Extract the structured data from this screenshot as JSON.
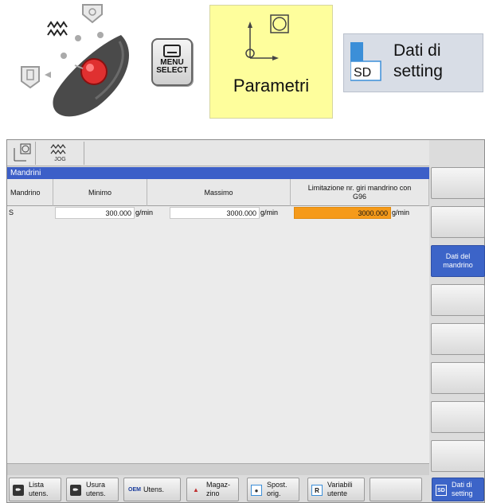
{
  "top_strip": {
    "menu_select_key": {
      "line1": "MENU",
      "line2": "SELECT"
    },
    "parametri_key": {
      "label": "Parametri"
    },
    "setting_key": {
      "icon_text": "SD",
      "line1": "Dati di",
      "line2": "setting"
    }
  },
  "hmi": {
    "header": {
      "mode_text": "JOG"
    },
    "panel_title": "Mandrini",
    "table": {
      "columns": {
        "spindle": "Mandrino",
        "min": "Minimo",
        "max": "Massimo",
        "limit": "Limitazione nr. giri mandrino con G96"
      },
      "rows": [
        {
          "spindle": "S",
          "min": "300.000",
          "min_unit": "g/min",
          "max": "3000.000",
          "max_unit": "g/min",
          "limit": "3000.000",
          "limit_unit": "g/min"
        }
      ]
    },
    "vertical_softkeys": [
      "",
      "",
      "Dati del mandrino",
      "",
      "",
      "",
      "",
      ""
    ],
    "active_vertical_softkey": "Dati del mandrino",
    "horizontal_softkeys": [
      {
        "icon_text": "",
        "label": "Lista\nutens."
      },
      {
        "icon_text": "",
        "label": "Usura\nutens."
      },
      {
        "icon_text": "OEM",
        "label": "Utens."
      },
      {
        "icon_text": "",
        "label": "Magaz-\nzino"
      },
      {
        "icon_text": "",
        "label": "Spost.\norig."
      },
      {
        "icon_text": "R",
        "label": "Variabili\nutente"
      },
      {
        "icon_text": "",
        "label": ""
      },
      {
        "icon_text": "SD",
        "label": "Dati di\nsetting"
      }
    ],
    "colors": {
      "title_bar": "#3c5fc8",
      "highlight_cell": "#f59a1a",
      "active_softkey": "#3c64c8"
    }
  }
}
